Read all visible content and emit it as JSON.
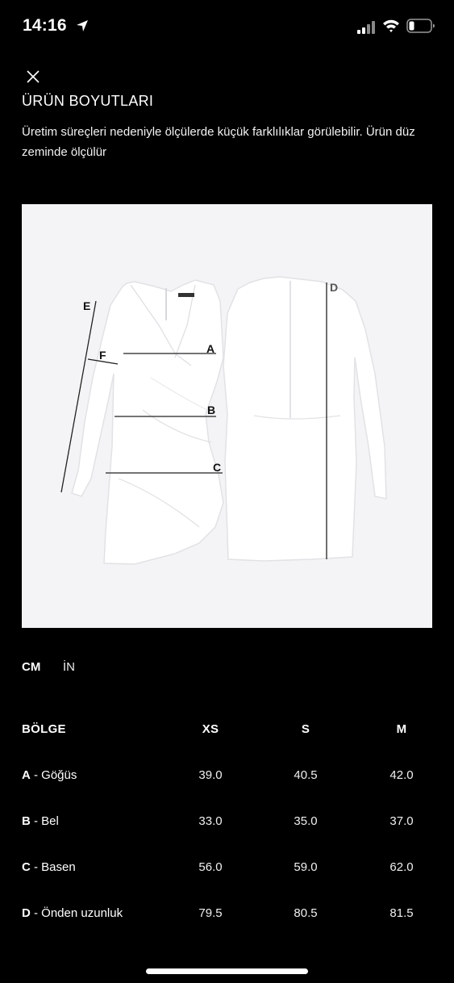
{
  "status_bar": {
    "time": "14:16",
    "icons": [
      "location-arrow-icon",
      "cellular-signal-icon",
      "wifi-icon",
      "battery-icon"
    ]
  },
  "close_icon": "close-icon",
  "title": "ÜRÜN BOYUTLARI",
  "description": "Üretim süreçleri nedeniyle ölçülerde küçük farklılıklar görülebilir. Ürün düz zeminde ölçülür",
  "diagram": {
    "image": "white-dress-measurement-diagram",
    "labels": {
      "a": "A",
      "b": "B",
      "c": "C",
      "d": "D",
      "e": "E",
      "f": "F"
    }
  },
  "units": {
    "cm": "CM",
    "in": "İN",
    "selected": "CM"
  },
  "table": {
    "headers": [
      "BÖLGE",
      "XS",
      "S",
      "M"
    ],
    "rows": [
      {
        "letter": "A",
        "name": " - Göğüs",
        "values": [
          "39.0",
          "40.5",
          "42.0"
        ]
      },
      {
        "letter": "B",
        "name": " - Bel",
        "values": [
          "33.0",
          "35.0",
          "37.0"
        ]
      },
      {
        "letter": "C",
        "name": " - Basen",
        "values": [
          "56.0",
          "59.0",
          "62.0"
        ]
      },
      {
        "letter": "D",
        "name": " - Önden uzunluk",
        "values": [
          "79.5",
          "80.5",
          "81.5"
        ]
      }
    ]
  },
  "colors": {
    "background": "#000000",
    "diagram_bg": "#f4f4f6",
    "text": "#ffffff"
  }
}
